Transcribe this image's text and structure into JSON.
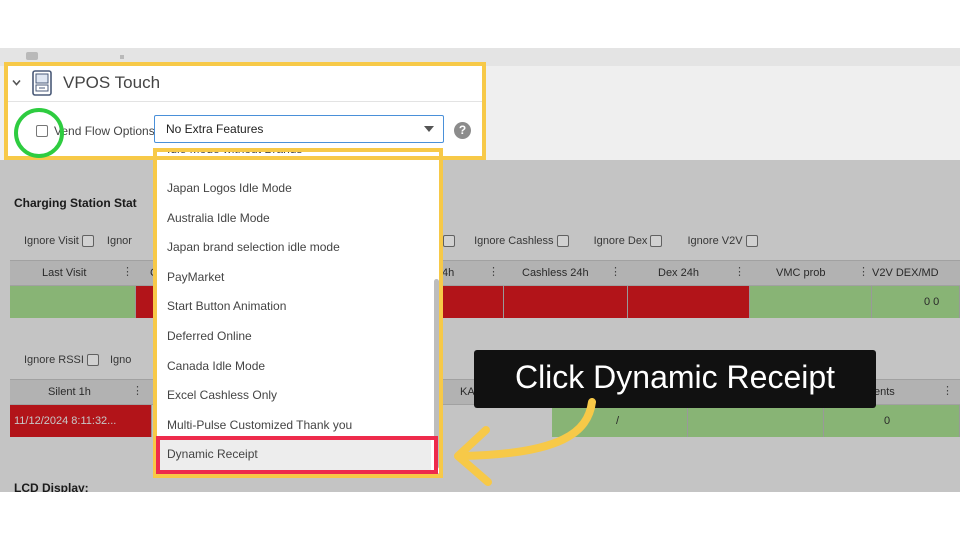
{
  "panel": {
    "title": "VPOS Touch",
    "vend_label": "Vend Flow Options",
    "select_value": "No Extra Features",
    "help": "?"
  },
  "dropdown": {
    "partial_item": "Idle Mode without Brands",
    "items": [
      "Japan Logos Idle Mode",
      "Australia Idle Mode",
      "Japan brand selection idle mode",
      "PayMarket",
      "Start Button Animation",
      "Deferred Online",
      "Canada Idle Mode",
      "Excel Cashless Only",
      "Multi-Pulse Customized Thank you",
      "Dynamic Receipt"
    ],
    "selected": "Dynamic Receipt"
  },
  "charging": {
    "title": "Charging Station Stat",
    "ignore_left": [
      "Ignore Visit",
      "Ignor"
    ],
    "ignore_right": [
      "Ignore Cashless",
      "Ignore Dex",
      "Ignore V2V"
    ],
    "headers": [
      "Last Visit",
      "C",
      "4h",
      "Cashless 24h",
      "Dex 24h",
      "VMC prob",
      "V2V DEX/MD"
    ],
    "row_value": "0 0"
  },
  "second": {
    "ignore_left": [
      "Ignore RSSI",
      "Igno"
    ],
    "headers": [
      "Silent 1h",
      "KA",
      "ents"
    ],
    "row_values": [
      "11/12/2024 8:11:32...",
      "/",
      "0"
    ]
  },
  "lcd": {
    "title": "LCD Display:"
  },
  "callout": {
    "text": "Click Dynamic Receipt"
  },
  "colors": {
    "highlight_yellow": "#f7c948",
    "highlight_red": "#ee2b4c",
    "highlight_green": "#2ecc40",
    "status_red": "#d9191f",
    "status_green": "#a6dc8f"
  }
}
